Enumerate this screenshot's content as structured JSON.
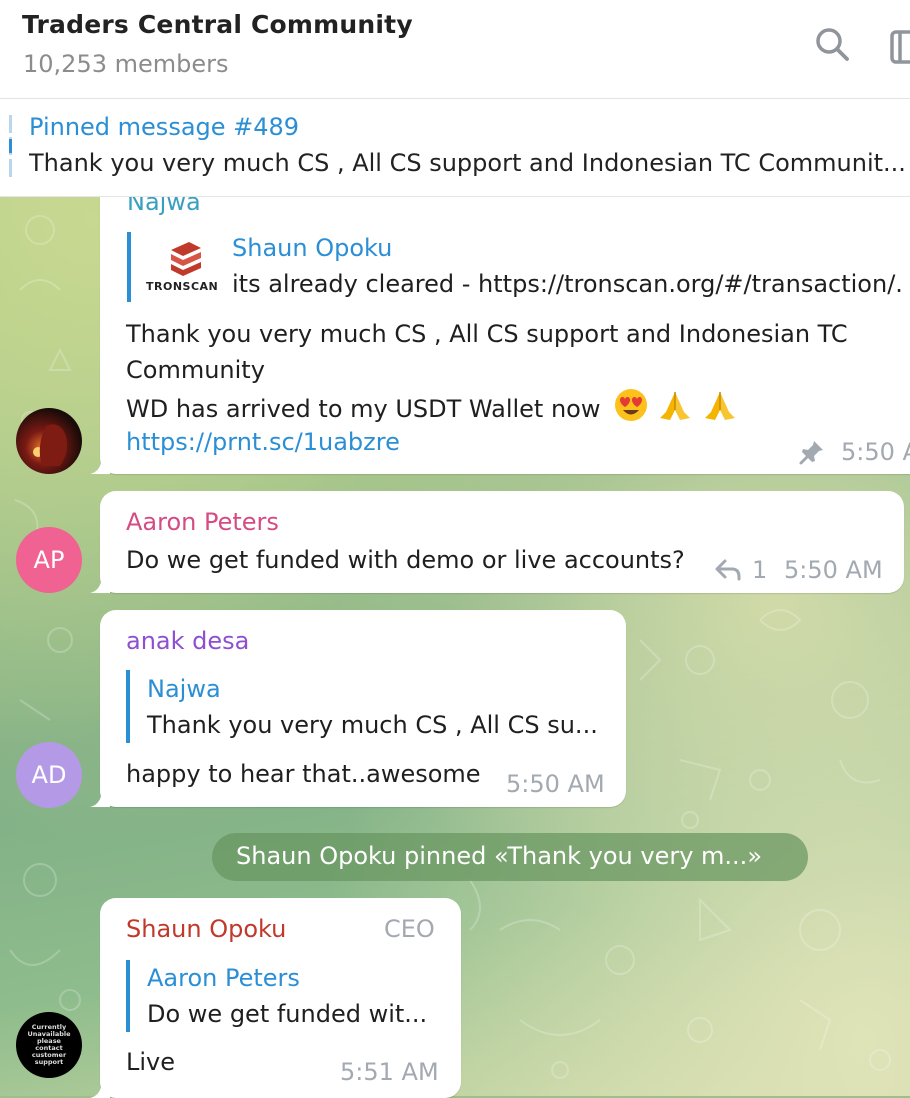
{
  "header": {
    "title": "Traders Central Community",
    "members": "10,253 members"
  },
  "pinned": {
    "title": "Pinned message #489",
    "text": "Thank you very much CS , All CS support and Indonesian TC Communit..."
  },
  "messages": {
    "najwa": {
      "sender": "Najwa",
      "reply_name": "Shaun Opoku",
      "reply_text": "its already cleared - https://tronscan.org/#/transaction/.",
      "reply_logo_text": "TRONSCAN",
      "line1": "Thank you very much CS , All CS support and Indonesian TC",
      "line2": "Community",
      "line3": "WD has arrived to my USDT Wallet now",
      "link": "https://prnt.sc/1uabzre",
      "time": "5:50 A"
    },
    "aaron": {
      "sender": "Aaron Peters",
      "initials": "AP",
      "text": "Do we get funded with demo or live accounts?",
      "reply_count": "1",
      "time": "5:50 AM"
    },
    "anak": {
      "sender": "anak desa",
      "initials": "AD",
      "reply_name": "Najwa",
      "reply_text": "Thank you very much CS , All CS su...",
      "text": "happy to hear that..awesome",
      "time": "5:50 AM"
    },
    "service": "Shaun Opoku pinned «Thank you very m...»",
    "shaun": {
      "sender": "Shaun Opoku",
      "badge": "CEO",
      "reply_name": "Aaron Peters",
      "reply_text": "Do we get funded wit...",
      "text": "Live",
      "time": "5:51 AM",
      "avatar_text": "Currently Unavailable please contact customer support"
    }
  },
  "colors": {
    "accent": "#2b8fd6",
    "aaron": "#d54b83",
    "anak": "#8e4fd1",
    "shaun": "#c0392b",
    "avatar_ap": "#f06292",
    "avatar_ad": "#b49ae6"
  }
}
